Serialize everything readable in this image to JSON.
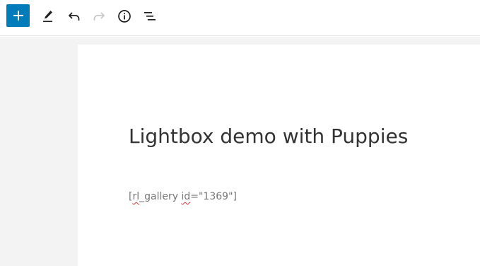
{
  "toolbar": {
    "add_block": {
      "icon": "plus-icon",
      "color": "#007cba"
    },
    "edit": {
      "icon": "pencil-icon"
    },
    "undo": {
      "icon": "undo-icon"
    },
    "redo": {
      "icon": "redo-icon",
      "disabled": true
    },
    "info": {
      "icon": "info-icon"
    },
    "outline": {
      "icon": "list-view-icon"
    }
  },
  "editor": {
    "title": "Lightbox demo with Puppies",
    "shortcode": {
      "open": "[",
      "tag": "rl",
      "name_rest": "_gallery ",
      "attr": "id",
      "value": "=\"1369\"]"
    }
  },
  "colors": {
    "accent": "#007cba",
    "canvas_bg": "#f3f3f3",
    "title_text": "#333333",
    "shortcode_text": "#767676",
    "spellcheck": "#d63638"
  }
}
